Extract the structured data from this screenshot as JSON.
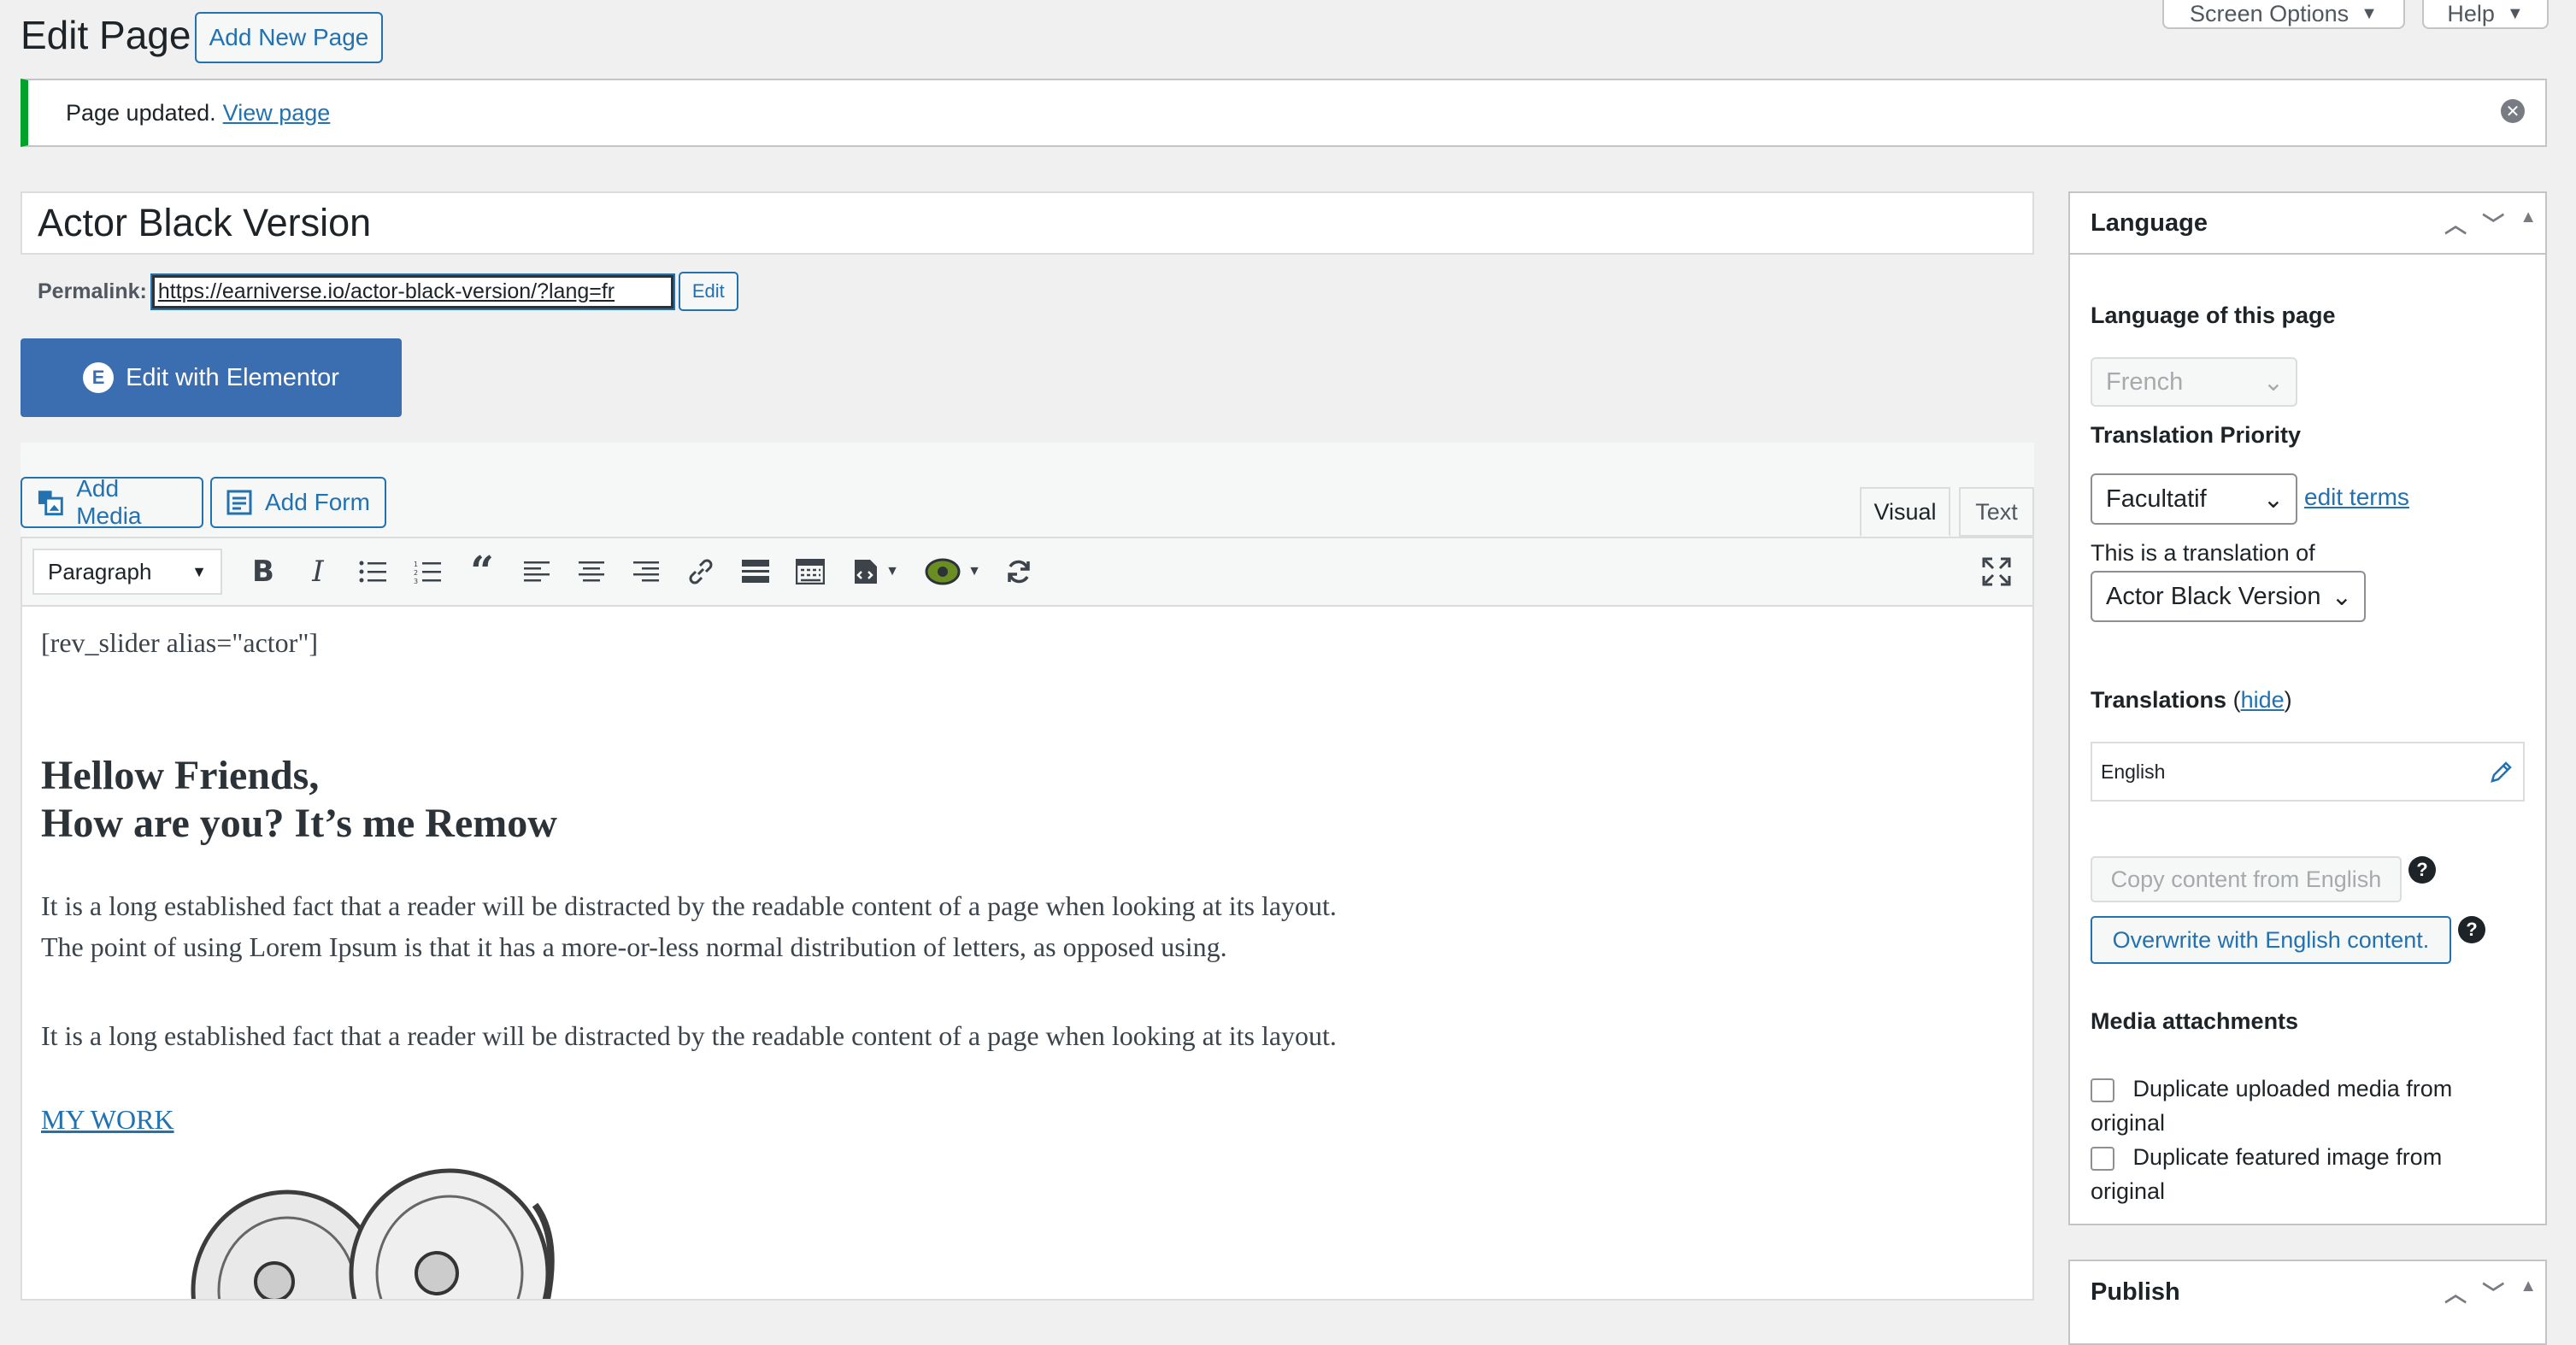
{
  "header": {
    "title": "Edit Page",
    "add_new_label": "Add New Page",
    "screen_options_label": "Screen Options",
    "help_label": "Help"
  },
  "notice": {
    "message": "Page updated.",
    "link": "View page"
  },
  "post": {
    "title": "Actor Black Version",
    "permalink_label": "Permalink:",
    "permalink_url": "https://earniverse.io/actor-black-version/?lang=fr",
    "permalink_edit": "Edit"
  },
  "elementor": {
    "label": "Edit with Elementor",
    "icon_letter": "E"
  },
  "media": {
    "add_media": "Add Media",
    "add_form": "Add Form"
  },
  "tabs": {
    "visual": "Visual",
    "text": "Text"
  },
  "toolbar": {
    "format": "Paragraph"
  },
  "content": {
    "shortcode": "[rev_slider alias=\"actor\"]",
    "heading_line1": "Hellow Friends,",
    "heading_line2": "How are you? It’s me Remow",
    "para1_line1": "It is a long established fact that a reader will be distracted by the readable content of a page when looking at its layout.",
    "para1_line2": "The point of using Lorem Ipsum is that it has a more-or-less normal distribution of letters, as opposed using.",
    "para2": "It is a long established fact that a reader will be distracted by the readable content of a page when looking at its layout.",
    "link": "MY WORK"
  },
  "language_box": {
    "title": "Language",
    "lang_of_page_label": "Language of this page",
    "lang_value": "French",
    "priority_label": "Translation Priority",
    "priority_value": "Facultatif",
    "edit_terms": "edit terms",
    "translation_of_label": "This is a translation of",
    "translation_of_value": "Actor Black Version",
    "translations_label": "Translations",
    "hide_link": "hide",
    "translation_lang": "English",
    "copy_btn": "Copy content from English",
    "overwrite_btn": "Overwrite with English content.",
    "media_label": "Media attachments",
    "dup_media_line1": "Duplicate uploaded media from",
    "dup_media_line2": "original",
    "dup_featured_line1": "Duplicate featured image from",
    "dup_featured_line2": "original"
  },
  "publish_box": {
    "title": "Publish"
  }
}
